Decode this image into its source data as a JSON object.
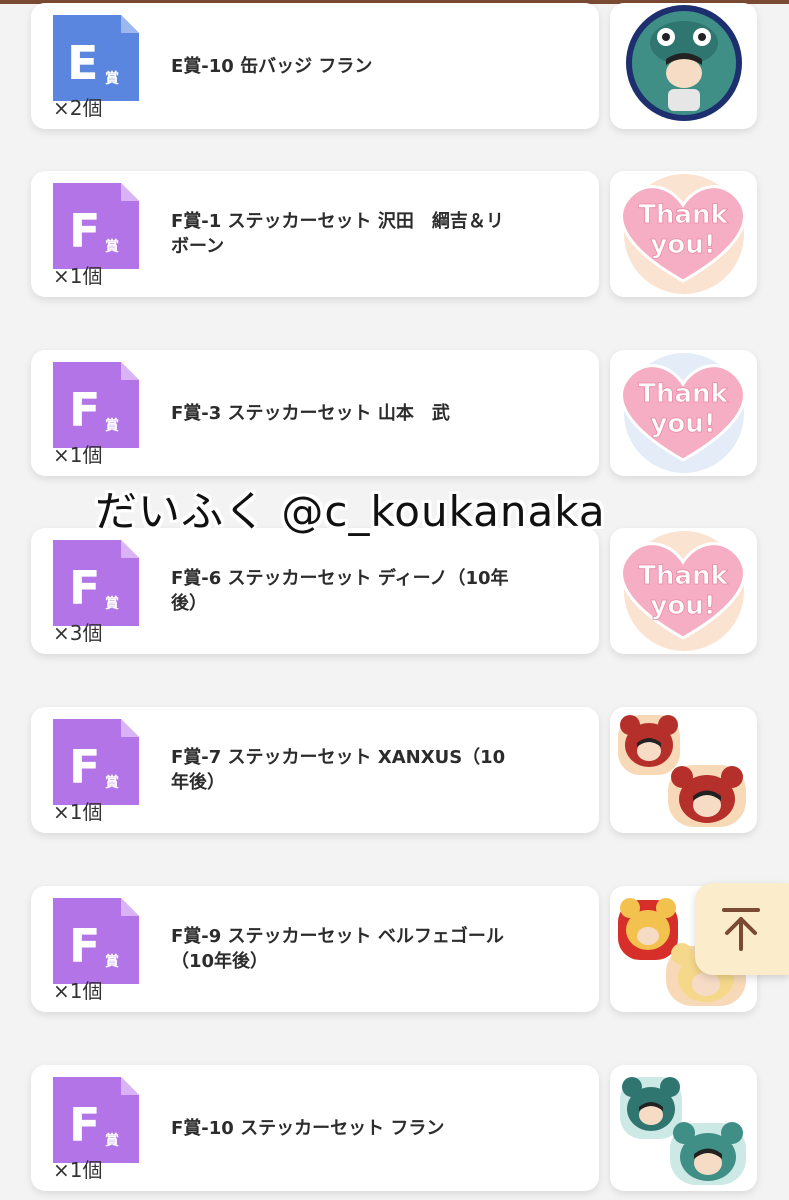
{
  "colors": {
    "e_badge": "#5b86e0",
    "f_badge": "#b274e6",
    "page_bg": "#f3f3f3",
    "scroll_top_bg": "#fbeccc",
    "scroll_top_arrow": "#7a4a33"
  },
  "items": [
    {
      "badge": "E",
      "badge_suffix": "賞",
      "title_line1": "E賞-10 缶バッジ フラン",
      "title_line2": "",
      "count": "×2個",
      "thumb": "can-badge-fran-image"
    },
    {
      "badge": "F",
      "badge_suffix": "賞",
      "title_line1": "F賞-1 ステッカーセット 沢田　綱吉＆リ",
      "title_line2": "ボーン",
      "count": "×1個",
      "thumb": "thank-you-heart-image"
    },
    {
      "badge": "F",
      "badge_suffix": "賞",
      "title_line1": "F賞-3 ステッカーセット 山本　武",
      "title_line2": "",
      "count": "×1個",
      "thumb": "thank-you-heart-image"
    },
    {
      "badge": "F",
      "badge_suffix": "賞",
      "title_line1": "F賞-6 ステッカーセット ディーノ（10年",
      "title_line2": "後）",
      "count": "×3個",
      "thumb": "thank-you-heart-image"
    },
    {
      "badge": "F",
      "badge_suffix": "賞",
      "title_line1": "F賞-7 ステッカーセット XANXUS（10",
      "title_line2": "年後）",
      "count": "×1個",
      "thumb": "sticker-xanxus-image"
    },
    {
      "badge": "F",
      "badge_suffix": "賞",
      "title_line1": "F賞-9 ステッカーセット ベルフェゴール",
      "title_line2": "（10年後）",
      "count": "×1個",
      "thumb": "sticker-belphegor-image"
    },
    {
      "badge": "F",
      "badge_suffix": "賞",
      "title_line1": "F賞-10 ステッカーセット フラン",
      "title_line2": "",
      "count": "×1個",
      "thumb": "sticker-fran-image"
    }
  ],
  "thank_you_text_1": "Thank",
  "thank_you_text_2": "you!",
  "watermark": "だいふく @c_koukanaka",
  "scroll_top_icon": "arrow-up-icon"
}
